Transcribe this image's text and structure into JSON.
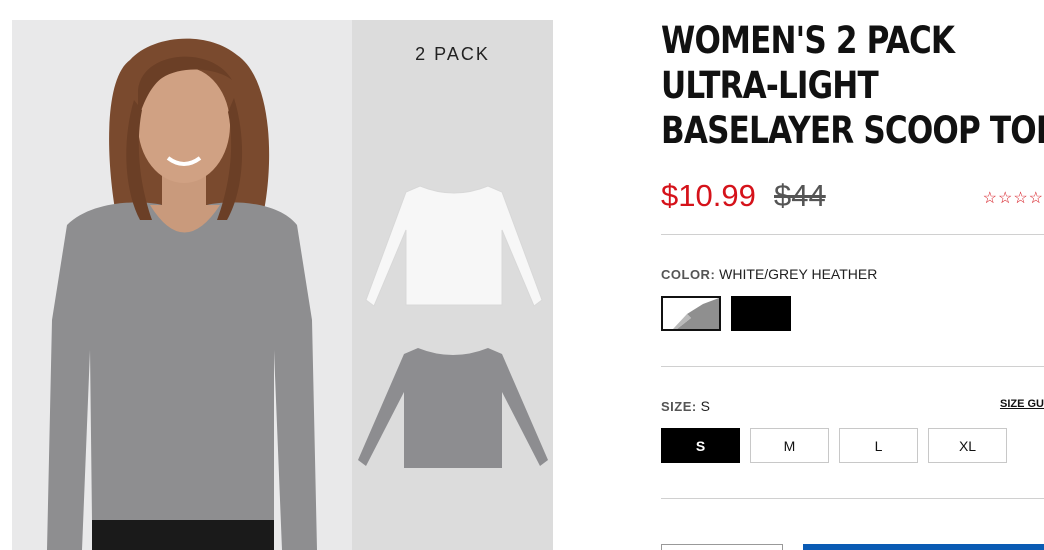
{
  "gallery": {
    "pack_label": "2 PACK"
  },
  "product": {
    "title_lines": [
      "WOMEN'S 2 PACK",
      "ULTRA-LIGHT",
      "BASELAYER SCOOP TOP"
    ],
    "sale_price": "$10.99",
    "original_price": "$44",
    "rating_stars": "☆☆☆☆"
  },
  "color": {
    "label": "COLOR:",
    "value": "WHITE/GREY HEATHER",
    "swatches": [
      {
        "name": "WHITE/GREY HEATHER",
        "selected": true
      },
      {
        "name": "BLACK",
        "selected": false
      }
    ]
  },
  "size": {
    "label": "SIZE:",
    "value": "S",
    "guide_label": "SIZE GU",
    "options": [
      "S",
      "M",
      "L",
      "XL"
    ],
    "selected": "S"
  },
  "colors": {
    "sale": "#d5121a",
    "add_to_cart": "#0a5bb4",
    "photo_bg": "#e9e9ea",
    "panel_bg": "#dcdcdc"
  }
}
